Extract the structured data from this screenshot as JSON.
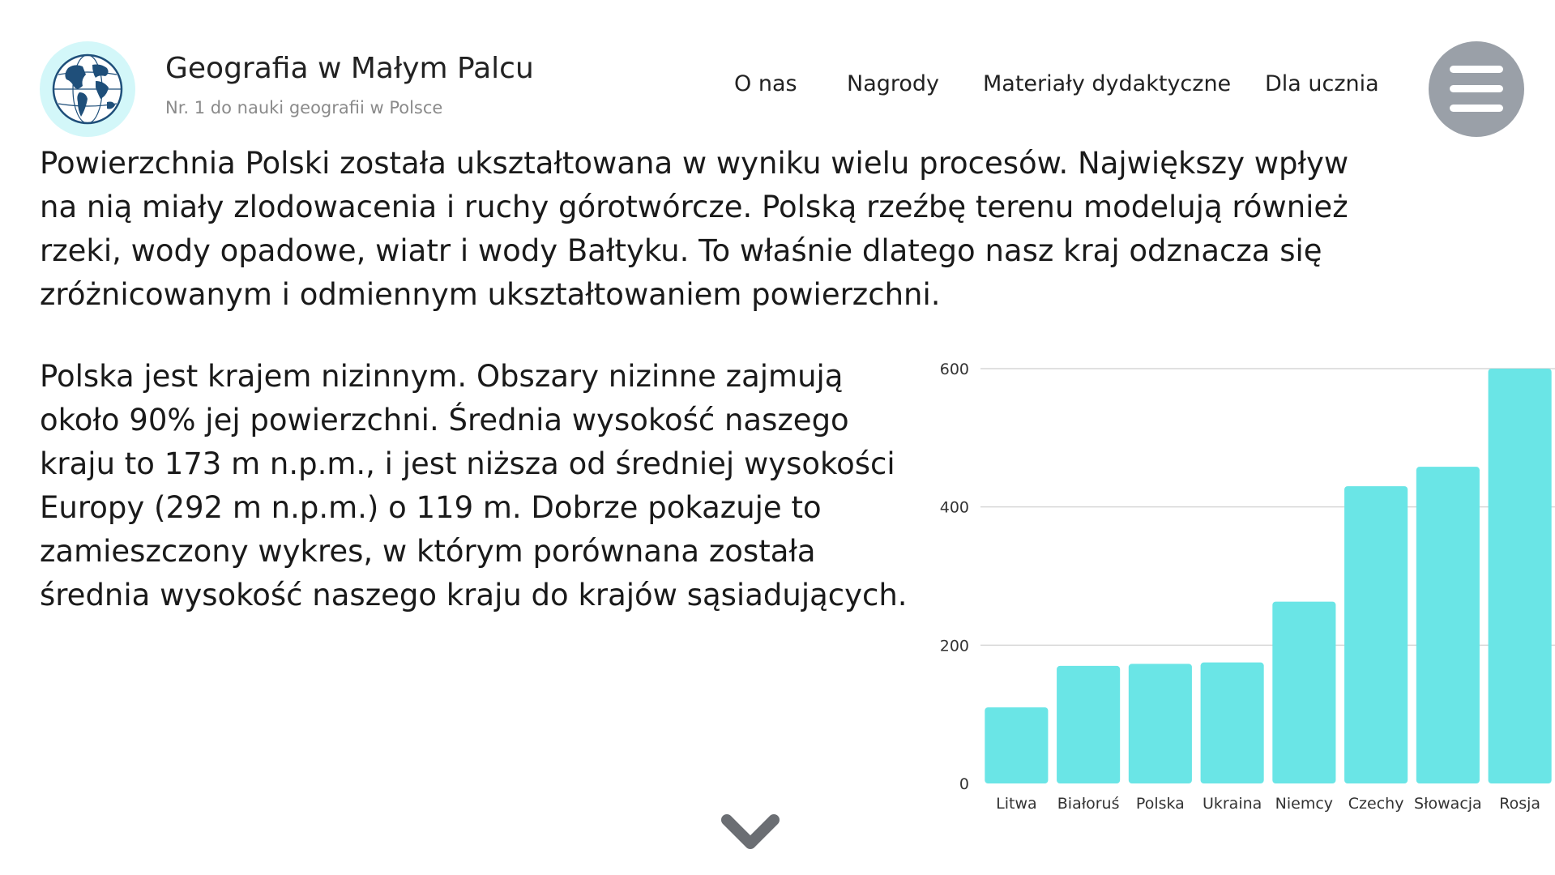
{
  "header": {
    "logo_icon": "globe-icon",
    "title": "Geografia w Małym Palcu",
    "subtitle": "Nr. 1 do nauki geografii w Polsce",
    "nav": [
      "O nas",
      "Nagrody",
      "Materiały dydaktyczne",
      "Dla ucznia"
    ],
    "menu_icon": "hamburger-menu-icon"
  },
  "content": {
    "paragraph1": "Powierzchnia Polski została ukształtowana w wyniku wielu procesów. Największy wpływ na nią miały zlodowacenia i ruchy górotwórcze. Polską rzeźbę terenu modelują również rzeki, wody opadowe, wiatr i wody Bałtyku. To właśnie dlatego nasz kraj odznacza się zróżnicowanym i odmiennym ukształtowaniem powierzchni.",
    "paragraph2": "Polska jest krajem nizinnym. Obszary nizinne zajmują około 90% jej powierzchni. Średnia wysokość naszego kraju to 173 m n.p.m., i jest niższa od średniej wysokości Europy (292 m n.p.m.) o 119 m. Dobrze pokazuje to zamieszczony wykres, w którym porównana została średnia wysokość naszego kraju do krajów sąsiadujących."
  },
  "scroll_icon": "chevron-down-icon",
  "colors": {
    "bar": "#6ae5e6",
    "logo_bg": "#d3f7f9",
    "menu_bg": "#9aa0a8",
    "chevron": "#6b6e73"
  },
  "chart_data": {
    "type": "bar",
    "categories": [
      "Litwa",
      "Białoruś",
      "Polska",
      "Ukraina",
      "Niemcy",
      "Czechy",
      "Słowacja",
      "Rosja"
    ],
    "values": [
      110,
      170,
      173,
      175,
      263,
      430,
      458,
      600
    ],
    "title": "",
    "xlabel": "",
    "ylabel": "",
    "ylim": [
      0,
      600
    ],
    "yticks": [
      0,
      200,
      400,
      600
    ],
    "grid": true,
    "legend": "none"
  }
}
